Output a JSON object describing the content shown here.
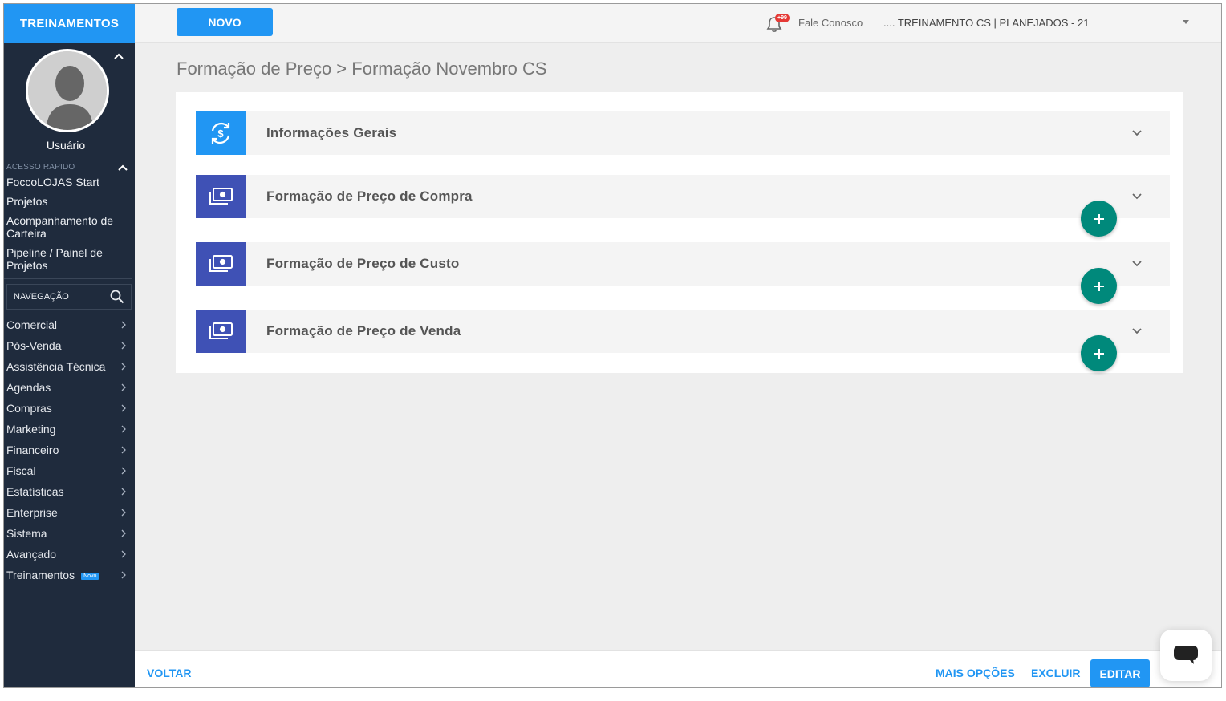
{
  "sidebar": {
    "brand": "TREINAMENTOS",
    "username": "Usuário",
    "quick_access_title": "ACESSO RAPIDO",
    "quick_access": [
      "FoccoLOJAS Start",
      "Projetos",
      "Acompanhamento de Carteira",
      "Pipeline / Painel de Projetos"
    ],
    "nav_search_label": "NAVEGAÇÃO",
    "nav_items": [
      "Comercial",
      "Pós-Venda",
      "Assistência Técnica",
      "Agendas",
      "Compras",
      "Marketing",
      "Financeiro",
      "Fiscal",
      "Estatísticas",
      "Enterprise",
      "Sistema",
      "Avançado",
      "Treinamentos"
    ],
    "new_badge": "Novo"
  },
  "topbar": {
    "new_button": "NOVO",
    "notification_badge": "+99",
    "contact_link": "Fale Conosco",
    "company_selector": ".... TREINAMENTO CS | PLANEJADOS - 21"
  },
  "breadcrumb": "Formação de Preço > Formação Novembro CS",
  "sections": [
    {
      "title": "Informações Gerais",
      "icon": "dollar-sync-icon"
    },
    {
      "title": "Formação de Preço de Compra",
      "icon": "money-bill-icon"
    },
    {
      "title": "Formação de Preço de Custo",
      "icon": "money-bill-icon"
    },
    {
      "title": "Formação de Preço de Venda",
      "icon": "money-bill-icon"
    }
  ],
  "bottombar": {
    "back": "VOLTAR",
    "more_options": "MAIS OPÇÕES",
    "delete": "EXCLUIR",
    "edit": "EDITAR"
  },
  "colors": {
    "primary": "#2196f3",
    "sidebar_bg": "#1f2b3d",
    "section_icon_blue": "#2196f3",
    "section_icon_indigo": "#3f51b5",
    "fab_green": "#00897b",
    "notification_red": "#e53935"
  }
}
